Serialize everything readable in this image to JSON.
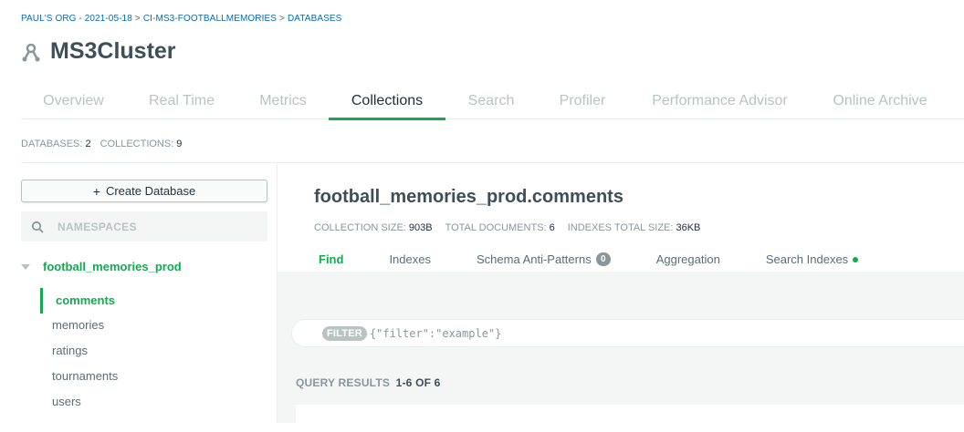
{
  "breadcrumb": {
    "org": "PAUL'S ORG - 2021-05-18",
    "sep1": ">",
    "project": "CI-MS3-FOOTBALLMEMORIES",
    "sep2": ">",
    "page": "DATABASES"
  },
  "cluster": {
    "title": "MS3Cluster",
    "icon": "cluster-icon"
  },
  "tabs": [
    {
      "label": "Overview",
      "active": false
    },
    {
      "label": "Real Time",
      "active": false
    },
    {
      "label": "Metrics",
      "active": false
    },
    {
      "label": "Collections",
      "active": true
    },
    {
      "label": "Search",
      "active": false
    },
    {
      "label": "Profiler",
      "active": false
    },
    {
      "label": "Performance Advisor",
      "active": false
    },
    {
      "label": "Online Archive",
      "active": false
    }
  ],
  "counts": {
    "databases_label": "DATABASES:",
    "databases_value": "2",
    "collections_label": "COLLECTIONS:",
    "collections_value": "9"
  },
  "sidebar": {
    "create_label": "Create Database",
    "create_icon": "plus-icon",
    "namespace_placeholder": "NAMESPACES",
    "database": "football_memories_prod",
    "collections": [
      "comments",
      "memories",
      "ratings",
      "tournaments",
      "users"
    ],
    "active_collection": "comments"
  },
  "collection": {
    "title": "football_memories_prod.comments",
    "size_label": "COLLECTION SIZE:",
    "size_value": "903B",
    "docs_label": "TOTAL DOCUMENTS:",
    "docs_value": "6",
    "indexes_label": "INDEXES TOTAL SIZE:",
    "indexes_value": "36KB",
    "subtabs": {
      "find": "Find",
      "indexes": "Indexes",
      "schema": "Schema Anti-Patterns",
      "schema_badge": "0",
      "aggregation": "Aggregation",
      "search_indexes": "Search Indexes"
    },
    "filter_label": "FILTER",
    "filter_value": "{\"filter\":\"example\"}",
    "results_label": "QUERY RESULTS",
    "results_value": "1-6 OF 6"
  },
  "colors": {
    "accent": "#13aa52",
    "link": "#006cbc",
    "muted": "#b8c4c2",
    "text": "#3d4f58"
  }
}
